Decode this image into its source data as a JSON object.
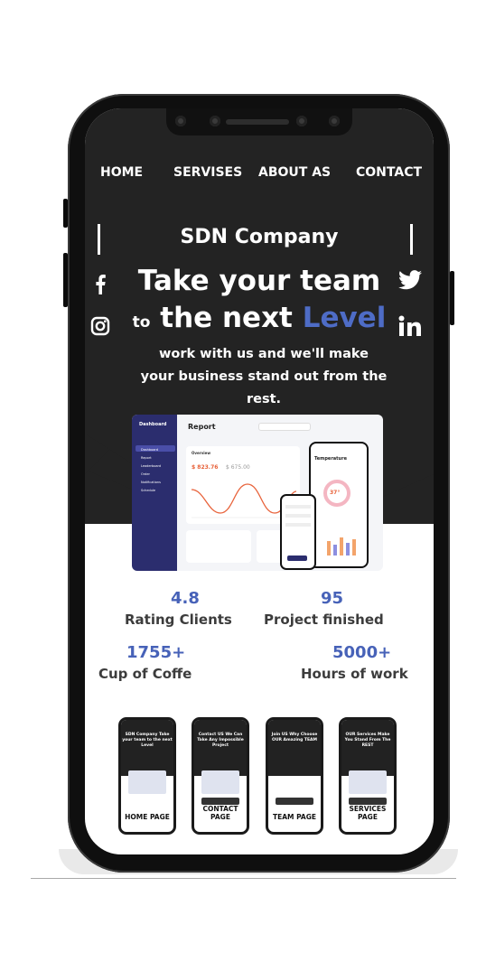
{
  "nav": {
    "home": "HOME",
    "services": "SERVISES",
    "about": "ABOUT AS",
    "contact": "CONTACT"
  },
  "hero": {
    "company": "SDN Company",
    "line1": "Take your team",
    "line2_to": "to",
    "line2_main": "the next",
    "line2_accent": "Level",
    "sub_line1": "work with us and we'll make",
    "sub_line2": "your business stand out from the",
    "sub_line3": "rest."
  },
  "social": {
    "left": [
      "facebook-icon",
      "instagram-icon"
    ],
    "right": [
      "twitter-icon",
      "linkedin-icon"
    ]
  },
  "dashboard": {
    "brand": "Dashboard",
    "title": "Report",
    "sidebar": [
      "Dashboard",
      "Report",
      "Leaderboard",
      "Order",
      "Notifications",
      "Schedule"
    ],
    "overview": "Overview",
    "total_revenue": "$ 823.76",
    "total_last": "$ 675.00",
    "phone_title": "Temperature",
    "phone_value": "37°"
  },
  "stats": [
    {
      "value": "4.8",
      "label": "Rating Clients"
    },
    {
      "value": "95",
      "label": "Project finished"
    },
    {
      "value": "1755+",
      "label": "Cup of Coffe"
    },
    {
      "value": "5000+",
      "label": "Hours of work"
    }
  ],
  "thumbs": [
    {
      "heading": "SDN Company Take your team to the next Level",
      "label": "HOME PAGE"
    },
    {
      "heading": "Contact US We Can Take Any Impossible Project",
      "label": "CONTACT PAGE"
    },
    {
      "heading": "Join US Why Choose OUR Amazing TEAM",
      "label": "TEAM PAGE"
    },
    {
      "heading": "OUR Services Make You Stand From The REST",
      "label": "SERVICES PAGE"
    }
  ],
  "colors": {
    "accent": "#4e6cc6",
    "dark": "#232323",
    "sidebar": "#2b2d6e",
    "chart_line": "#e8623a"
  }
}
